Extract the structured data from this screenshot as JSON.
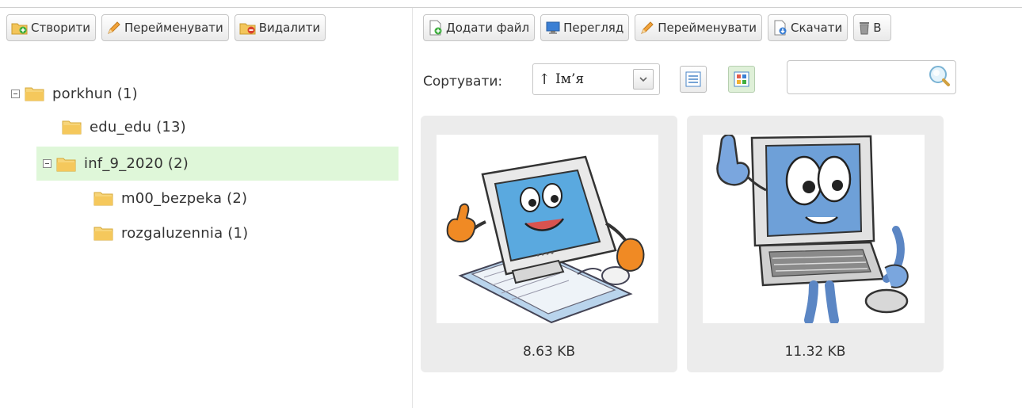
{
  "left_toolbar": {
    "create": "Створити",
    "rename": "Перейменувати",
    "delete": "Видалити"
  },
  "right_toolbar": {
    "add_file": "Додати файл",
    "preview": "Перегляд",
    "rename": "Перейменувати",
    "download": "Скачати",
    "delete_partial": "В"
  },
  "tree": {
    "root": "porkhun (1)",
    "edu": "edu_edu (13)",
    "inf": "inf_9_2020 (2)",
    "m00": "m00_bezpeka (2)",
    "rozg": "rozgaluzennia (1)"
  },
  "sort": {
    "label": "Сортувати:",
    "arrow": "↑",
    "value": "Ім’я"
  },
  "search": {
    "value": "",
    "placeholder": ""
  },
  "files": [
    {
      "size": "8.63 KB",
      "icon": "cartoon-computer-thumbs-up"
    },
    {
      "size": "11.32 KB",
      "icon": "cartoon-computer-pointing"
    }
  ],
  "colors": {
    "selected_row": "#dff7d9",
    "folder": "#f5c85c",
    "card_bg": "#ececec",
    "screen_blue": "#5aa9df"
  }
}
